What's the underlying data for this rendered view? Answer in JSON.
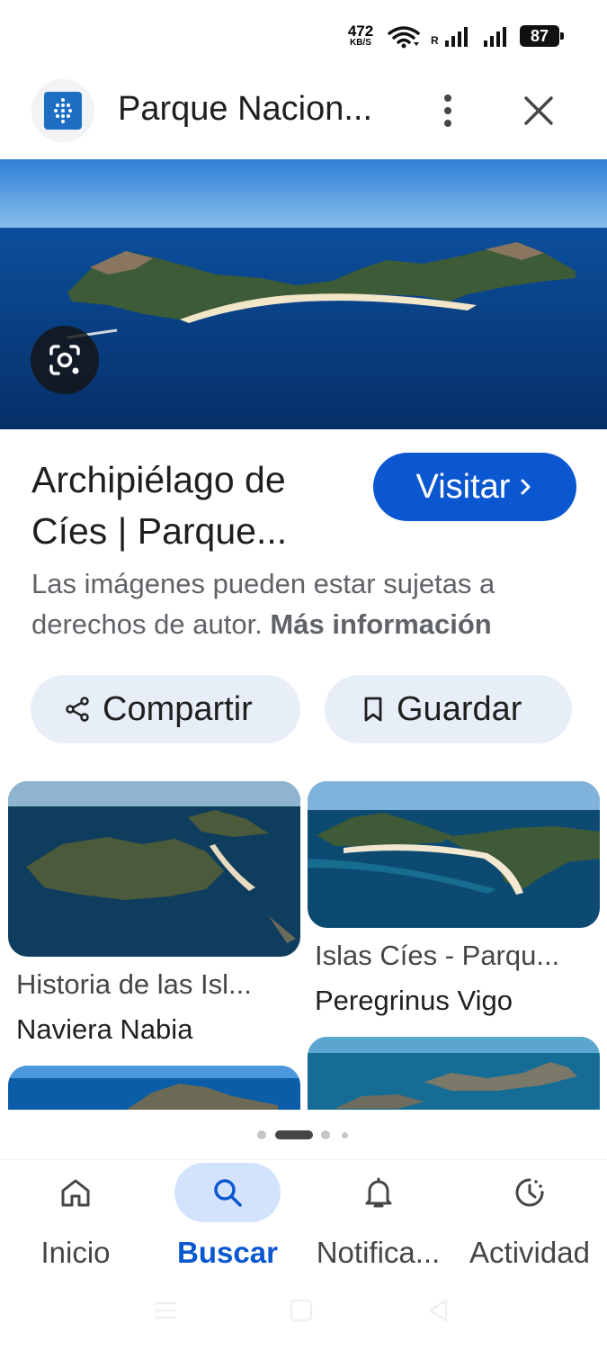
{
  "status_bar": {
    "net_speed": "472",
    "net_unit": "KB/S",
    "roaming": "R",
    "battery": "87"
  },
  "header": {
    "title": "Parque Nacion...",
    "logo_icon": "park-logo-icon",
    "more_icon": "more-vert-icon",
    "close_icon": "close-icon"
  },
  "result": {
    "title_line1": "Archipiélago de",
    "title_line2": "Cíes | Parque...",
    "visit_label": "Visitar",
    "copyright_text": "Las imágenes pueden estar sujetas a derechos de autor.",
    "more_info": "Más información"
  },
  "actions": {
    "share_label": "Compartir",
    "save_label": "Guardar"
  },
  "related": [
    {
      "title": "Historia de las Isl...",
      "source": "Naviera Nabia"
    },
    {
      "title": "Islas Cíes - Parqu...",
      "source": "Peregrinus Vigo"
    }
  ],
  "pager": {
    "count": 4,
    "active_index": 1
  },
  "bottom_nav": [
    {
      "label": "Inicio",
      "icon": "home-icon",
      "active": false
    },
    {
      "label": "Buscar",
      "icon": "search-icon",
      "active": true
    },
    {
      "label": "Notifica...",
      "icon": "bell-icon",
      "active": false
    },
    {
      "label": "Actividad",
      "icon": "activity-icon",
      "active": false
    }
  ],
  "colors": {
    "accent": "#0b57d0",
    "pill_bg": "#e8eef8",
    "active_nav_bg": "#d3e3fd"
  }
}
